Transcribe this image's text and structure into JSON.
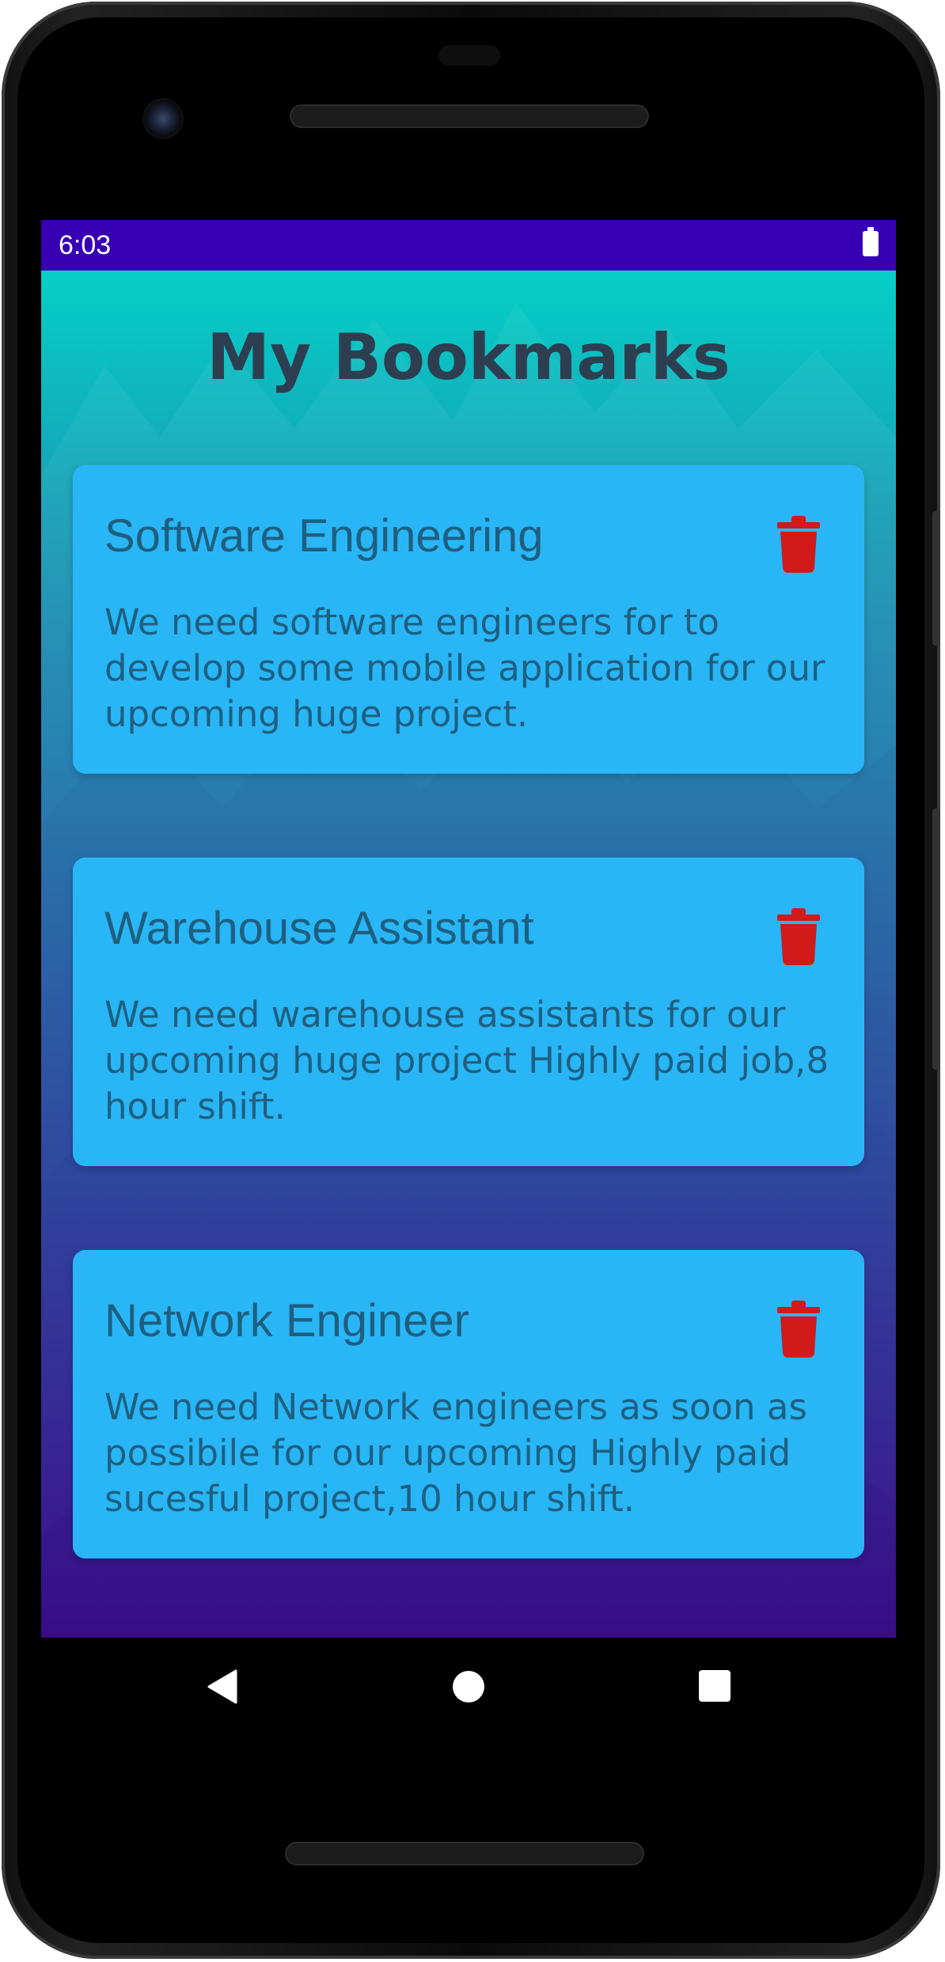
{
  "status_bar": {
    "time": "6:03"
  },
  "page": {
    "title": "My Bookmarks"
  },
  "bookmarks": [
    {
      "title": "Software Engineering",
      "description": "We need software engineers for to develop some mobile application for our upcoming huge project."
    },
    {
      "title": "Warehouse Assistant",
      "description": "We need warehouse assistants for our upcoming huge project Highly paid job,8 hour shift."
    },
    {
      "title": "Network Engineer",
      "description": "We need Network engineers as soon as possibile for our upcoming Highly paid sucesful project,10 hour shift."
    }
  ],
  "icons": {
    "delete": "trash-icon",
    "battery": "battery-icon",
    "back": "nav-back-icon",
    "home": "nav-home-icon",
    "recents": "nav-recents-icon"
  },
  "colors": {
    "status_bar": "#3700b3",
    "card": "#29b6f6",
    "card_text": "#1e5f80",
    "title_text": "#2c3e50",
    "delete_icon": "#d11a1a",
    "gradient_top": "#05cfc6",
    "gradient_bottom": "#37058a"
  }
}
